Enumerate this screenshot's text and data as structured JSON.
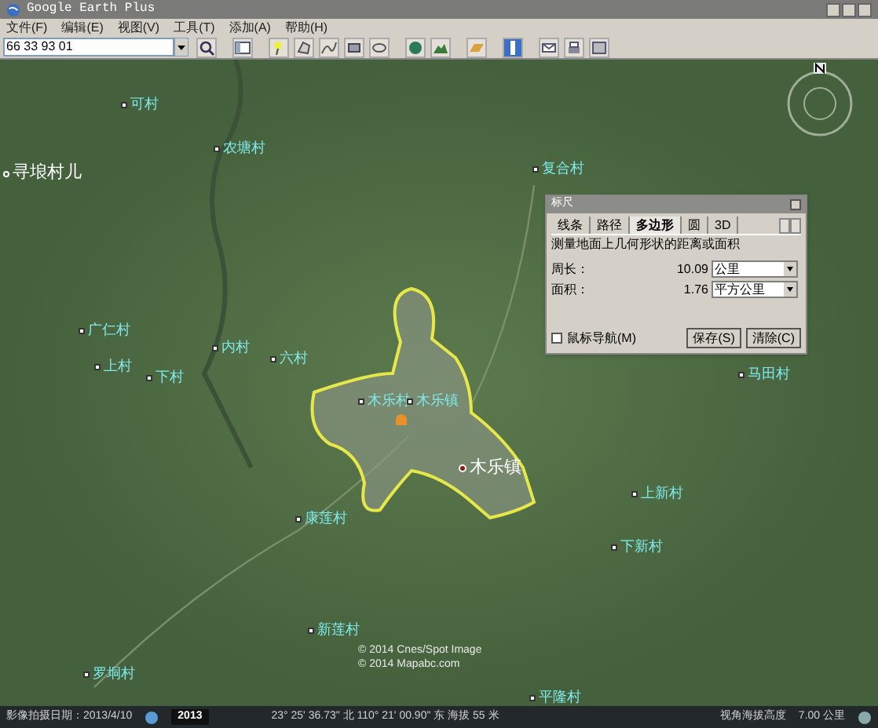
{
  "window": {
    "title": "Google Earth Plus"
  },
  "menu": [
    "文件(F)",
    "编辑(E)",
    "视图(V)",
    "工具(T)",
    "添加(A)",
    "帮助(H)"
  ],
  "search": {
    "value": "66 33 93 01"
  },
  "map": {
    "labels": [
      {
        "text": "可村",
        "kind": "village"
      },
      {
        "text": "农塘村",
        "kind": "village"
      },
      {
        "text": "寻埌村儿",
        "kind": "place"
      },
      {
        "text": "复合村",
        "kind": "village"
      },
      {
        "text": "广仁村",
        "kind": "village"
      },
      {
        "text": "上村",
        "kind": "village"
      },
      {
        "text": "内村",
        "kind": "village"
      },
      {
        "text": "六村",
        "kind": "village"
      },
      {
        "text": "下村",
        "kind": "village"
      },
      {
        "text": "木乐村",
        "kind": "village"
      },
      {
        "text": "木乐镇",
        "kind": "village"
      },
      {
        "text": "木乐镇",
        "kind": "town"
      },
      {
        "text": "马田村",
        "kind": "village"
      },
      {
        "text": "上新村",
        "kind": "village"
      },
      {
        "text": "下新村",
        "kind": "village"
      },
      {
        "text": "康莲村",
        "kind": "village"
      },
      {
        "text": "新莲村",
        "kind": "village"
      },
      {
        "text": "罗垌村",
        "kind": "village"
      },
      {
        "text": "平隆村",
        "kind": "village"
      }
    ],
    "copyright": [
      "© 2014 Cnes/Spot Image",
      "© 2014 Mapabc.com"
    ]
  },
  "ruler": {
    "title": "标尺",
    "tabs": [
      {
        "label": "线条",
        "selected": false
      },
      {
        "label": "路径",
        "selected": false
      },
      {
        "label": "多边形",
        "selected": true
      },
      {
        "label": "圆",
        "selected": false
      },
      {
        "label": "3D",
        "selected": false
      }
    ],
    "description": "测量地面上几何形状的距离或面积",
    "measures": [
      {
        "label": "周长：",
        "value": "10.09",
        "unit": "公里"
      },
      {
        "label": "面积：",
        "value": "1.76",
        "unit": "平方公里"
      }
    ],
    "mouse_nav": {
      "label": "鼠标导航(M)",
      "checked": false
    },
    "buttons": [
      "保存(S)",
      "清除(C)"
    ]
  },
  "status_bar": {
    "date": "影像拍摄日期：2013/4/10",
    "year": "2013",
    "coords": "23° 25' 36.73\" 北 110° 21' 00.90\" 东 海拔 55 米",
    "altitude": "视角海拔高度    7.00 公里"
  }
}
